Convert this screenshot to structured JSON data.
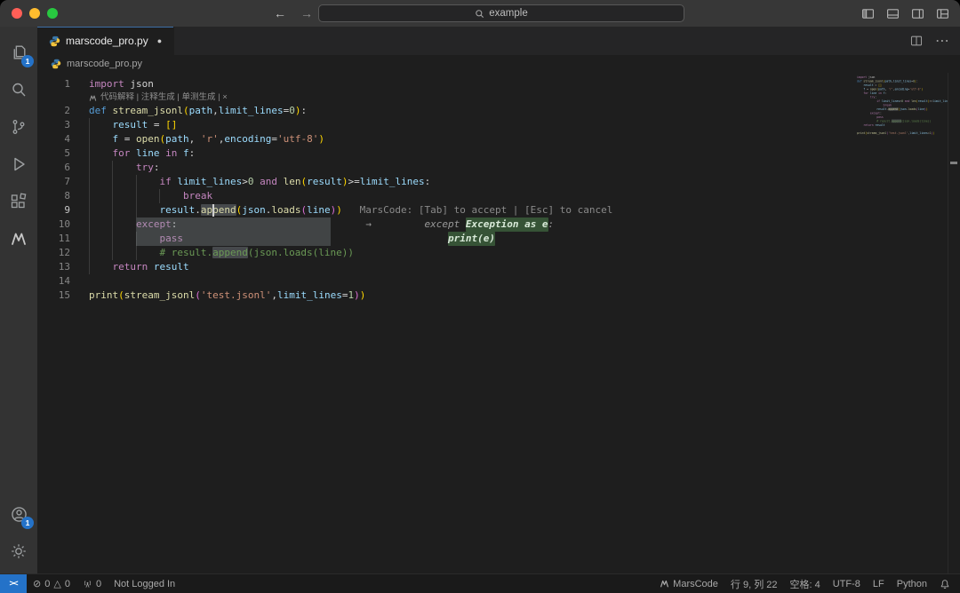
{
  "colors": {
    "accent": "#2472c8",
    "activity_bar": "#333333",
    "editor_bg": "#1e1e1e",
    "tab_bg": "#252526",
    "ghost_add_bg": "#4a804a",
    "traffic": [
      "#ff5f57",
      "#febc2e",
      "#28c840"
    ]
  },
  "icons": {
    "back": "←",
    "forward": "→",
    "tab_modified": "●",
    "more": "⋯",
    "remote": "><",
    "error": "⊘",
    "warning": "△"
  },
  "titlebar": {
    "search_text": "example"
  },
  "badges": {
    "explorer": "1",
    "account": "1"
  },
  "tabbar": {
    "tab_label": "marscode_pro.py"
  },
  "breadcrumb": "marscode_pro.py",
  "codelens_text": "代码解释 | 注释生成 | 单测生成 | ×",
  "editor": {
    "lines": [
      {
        "n": 1,
        "lens": true,
        "t": [
          [
            "import",
            "kw"
          ],
          [
            " ",
            "fg"
          ],
          [
            "json",
            "fg"
          ]
        ]
      },
      {
        "n": 2,
        "t": [
          [
            "def",
            "defkw"
          ],
          [
            " ",
            "fg"
          ],
          [
            "stream_jsonl",
            "fn"
          ],
          [
            "(",
            "br1"
          ],
          [
            "path",
            "var"
          ],
          [
            ",",
            "fg"
          ],
          [
            "limit_lines",
            "var"
          ],
          [
            "=",
            "fg"
          ],
          [
            "0",
            "num"
          ],
          [
            ")",
            "br1"
          ],
          [
            ":",
            "fg"
          ]
        ]
      },
      {
        "n": 3,
        "t": [
          [
            "    ",
            "fg"
          ],
          [
            "result",
            "var"
          ],
          [
            " = ",
            "fg"
          ],
          [
            "[]",
            "br1"
          ]
        ]
      },
      {
        "n": 4,
        "t": [
          [
            "    ",
            "fg"
          ],
          [
            "f",
            "var"
          ],
          [
            " = ",
            "fg"
          ],
          [
            "open",
            "fn"
          ],
          [
            "(",
            "br1"
          ],
          [
            "path",
            "var"
          ],
          [
            ", ",
            "fg"
          ],
          [
            "'r'",
            "str"
          ],
          [
            ",",
            "fg"
          ],
          [
            "encoding",
            "var"
          ],
          [
            "=",
            "fg"
          ],
          [
            "'utf-8'",
            "str"
          ],
          [
            ")",
            "br1"
          ]
        ]
      },
      {
        "n": 5,
        "t": [
          [
            "    ",
            "fg"
          ],
          [
            "for",
            "kw"
          ],
          [
            " ",
            "fg"
          ],
          [
            "line",
            "var"
          ],
          [
            " ",
            "fg"
          ],
          [
            "in",
            "kw"
          ],
          [
            " ",
            "fg"
          ],
          [
            "f",
            "var"
          ],
          [
            ":",
            "fg"
          ]
        ]
      },
      {
        "n": 6,
        "t": [
          [
            "        ",
            "fg"
          ],
          [
            "try",
            "kw"
          ],
          [
            ":",
            "fg"
          ]
        ]
      },
      {
        "n": 7,
        "t": [
          [
            "            ",
            "fg"
          ],
          [
            "if",
            "kw"
          ],
          [
            " ",
            "fg"
          ],
          [
            "limit_lines",
            "var"
          ],
          [
            ">",
            "fg"
          ],
          [
            "0",
            "num"
          ],
          [
            " ",
            "fg"
          ],
          [
            "and",
            "kw"
          ],
          [
            " ",
            "fg"
          ],
          [
            "len",
            "fn"
          ],
          [
            "(",
            "br1"
          ],
          [
            "result",
            "var"
          ],
          [
            ")",
            "br1"
          ],
          [
            ">=",
            "fg"
          ],
          [
            "limit_lines",
            "var"
          ],
          [
            ":",
            "fg"
          ]
        ]
      },
      {
        "n": 8,
        "t": [
          [
            "                ",
            "fg"
          ],
          [
            "break",
            "kw"
          ]
        ]
      },
      {
        "n": 9,
        "cursor": 21,
        "hint": {
          "col": 46,
          "text": "MarsCode: [Tab] to accept | [Esc] to cancel"
        },
        "t": [
          [
            "            ",
            "fg"
          ],
          [
            "result",
            "var"
          ],
          [
            ".",
            "fg"
          ],
          [
            "append",
            "fn whl"
          ],
          [
            "(",
            "br1"
          ],
          [
            "json",
            "var"
          ],
          [
            ".",
            "fg"
          ],
          [
            "loads",
            "fn"
          ],
          [
            "(",
            "br2"
          ],
          [
            "line",
            "var"
          ],
          [
            ")",
            "br2"
          ],
          [
            ")",
            "br1"
          ]
        ]
      },
      {
        "n": 10,
        "diffhl": {
          "start": 8,
          "width": 33
        },
        "ghost": [
          {
            "col": 47,
            "text": "→",
            "cls": ""
          },
          {
            "col": 57,
            "text": "except ",
            "cls": ""
          },
          {
            "col": 64,
            "text": "Exception as e",
            "cls": "add"
          },
          {
            "col": 78,
            "text": ":",
            "cls": ""
          }
        ],
        "t": [
          [
            "        ",
            "fg"
          ],
          [
            "except",
            "kw"
          ],
          [
            ":",
            "fg"
          ]
        ]
      },
      {
        "n": 11,
        "diffhl": {
          "start": 8,
          "width": 33
        },
        "ghost": [
          {
            "col": 61,
            "text": "print(e)",
            "cls": "add"
          }
        ],
        "t": [
          [
            "            ",
            "fg"
          ],
          [
            "pass",
            "kw"
          ]
        ]
      },
      {
        "n": 12,
        "t": [
          [
            "            # result.",
            "cm"
          ],
          [
            "append",
            "cm whl"
          ],
          [
            "(json.loads(line))",
            "cm"
          ]
        ]
      },
      {
        "n": 13,
        "t": [
          [
            "    ",
            "fg"
          ],
          [
            "return",
            "kw"
          ],
          [
            " ",
            "fg"
          ],
          [
            "result",
            "var"
          ]
        ]
      },
      {
        "n": 14,
        "t": []
      },
      {
        "n": 15,
        "t": [
          [
            "print",
            "fn"
          ],
          [
            "(",
            "br1"
          ],
          [
            "stream_jsonl",
            "fn"
          ],
          [
            "(",
            "br2"
          ],
          [
            "'test.jsonl'",
            "str"
          ],
          [
            ",",
            "fg"
          ],
          [
            "limit_lines",
            "var"
          ],
          [
            "=",
            "fg"
          ],
          [
            "1",
            "num"
          ],
          [
            ")",
            "br2"
          ],
          [
            ")",
            "br1"
          ]
        ]
      }
    ]
  },
  "statusbar": {
    "errors": "0",
    "warnings": "0",
    "ports": "0",
    "login": "Not Logged In",
    "marscode": "MarsCode",
    "cursor": "行 9, 列 22",
    "indent": "空格: 4",
    "encoding": "UTF-8",
    "eol": "LF",
    "language": "Python"
  }
}
